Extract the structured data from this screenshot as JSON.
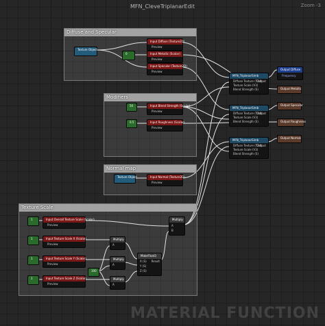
{
  "window": {
    "title": "MFN_CleveTriplanarEdit",
    "zoom": "Zoom -3"
  },
  "watermark": "MATERIAL FUNCTION",
  "comments": {
    "diffuse": "Diffuse and Specular",
    "modifiers": "Modifiers",
    "normal": "Normal map",
    "texscale": "Texture Scale"
  },
  "nodes": {
    "texture_object": {
      "title": "Texture Object"
    },
    "const_diffuse": {
      "title": "0"
    },
    "input_diffuse": {
      "title": "Input Diffuse (Texture2D)",
      "pin": "Preview"
    },
    "input_metallic": {
      "title": "Input Metallic (Scalar)",
      "pin": "Preview"
    },
    "input_specular": {
      "title": "Input Specular (Texture2D)",
      "pin": "Preview"
    },
    "const_blend": {
      "title": "50"
    },
    "input_blend": {
      "title": "Input Blend Strength (Scalar)",
      "pin": "Preview"
    },
    "const_roughness": {
      "title": "0.5"
    },
    "input_roughness": {
      "title": "Input Roughness (Scalar)",
      "pin": "Preview"
    },
    "tex_object_normal": {
      "title": "Texture Object"
    },
    "input_normal": {
      "title": "Input Normal (Texture2D)",
      "pin": "Preview"
    },
    "triplanar_1": {
      "title": "MFN_TriplanarSimb",
      "pins": [
        "Diffuse Texture (T2d)",
        "Texture Scale (V3)",
        "Blend Strength (S)"
      ],
      "out": "Output"
    },
    "triplanar_2": {
      "title": "MFN_TriplanarSimb",
      "pins": [
        "Diffuse Texture (T2d)",
        "Texture Scale (V3)",
        "Blend Strength (S)"
      ],
      "out": "Output"
    },
    "triplanar_3": {
      "title": "MFN_TriplanarSimb",
      "pins": [
        "Diffuse Texture (T2d)",
        "Texture Scale (V3)",
        "Blend Strength (S)"
      ],
      "out": "Output"
    },
    "out_diffuse": {
      "title": "Output Diffuse",
      "sub": "Frequency"
    },
    "out_metallic": {
      "title": "Output Metallic"
    },
    "out_specular": {
      "title": "Output Specular"
    },
    "out_roughness": {
      "title": "Output Roughness"
    },
    "out_normal": {
      "title": "Output Normal"
    },
    "const_overall": {
      "title": "1"
    },
    "input_overall": {
      "title": "Input Overall Texture Scale (Scalar)",
      "pin": "Preview"
    },
    "const_x": {
      "title": "1"
    },
    "input_x": {
      "title": "Input Texture Scale X (Scalar)",
      "pin": "Preview"
    },
    "const_y": {
      "title": "1"
    },
    "input_y": {
      "title": "Input Texture Scale Y (Scalar)",
      "pin": "Preview"
    },
    "const_z": {
      "title": "1"
    },
    "input_z": {
      "title": "Input Texture Scale Z (Scalar)",
      "pin": "Preview"
    },
    "multiply_x": {
      "title": "Multiply",
      "pins": [
        "A",
        "B"
      ]
    },
    "multiply_y": {
      "title": "Multiply",
      "pins": [
        "A",
        "B"
      ]
    },
    "multiply_z": {
      "title": "Multiply",
      "pins": [
        "A",
        "B"
      ]
    },
    "const_100": {
      "title": "100"
    },
    "make_float3": {
      "title": "MakeFloat3",
      "pins": [
        "X (S)",
        "Y (S)",
        "Z (S)"
      ],
      "out": "Result"
    },
    "multiply_final": {
      "title": "Multiply",
      "pins": [
        "A",
        "B"
      ]
    }
  },
  "colors": {
    "scalar_header": "#7a1717",
    "texture_header": "#235b7a",
    "const_header": "#2a6a2a",
    "output_header": "#1f3f8f"
  }
}
